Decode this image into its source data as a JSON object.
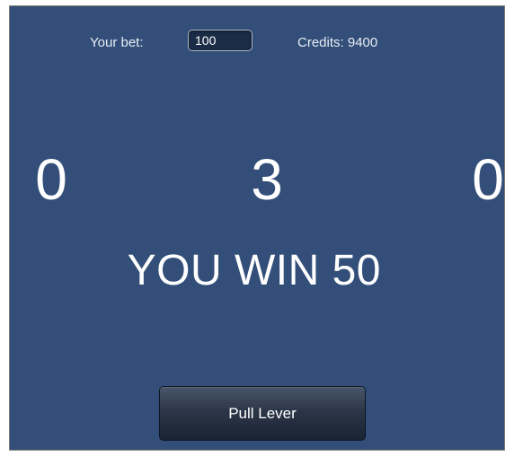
{
  "header": {
    "bet_label": "Your bet:",
    "bet_value": "100",
    "credits_text": "Credits: 9400"
  },
  "reels": [
    "0",
    "3",
    "0"
  ],
  "result": {
    "message": "YOU WIN 50"
  },
  "actions": {
    "pull_lever_label": "Pull Lever"
  },
  "colors": {
    "background": "#334f79",
    "text": "#ffffff",
    "button_top": "#48566b",
    "button_bottom": "#1a2333"
  }
}
